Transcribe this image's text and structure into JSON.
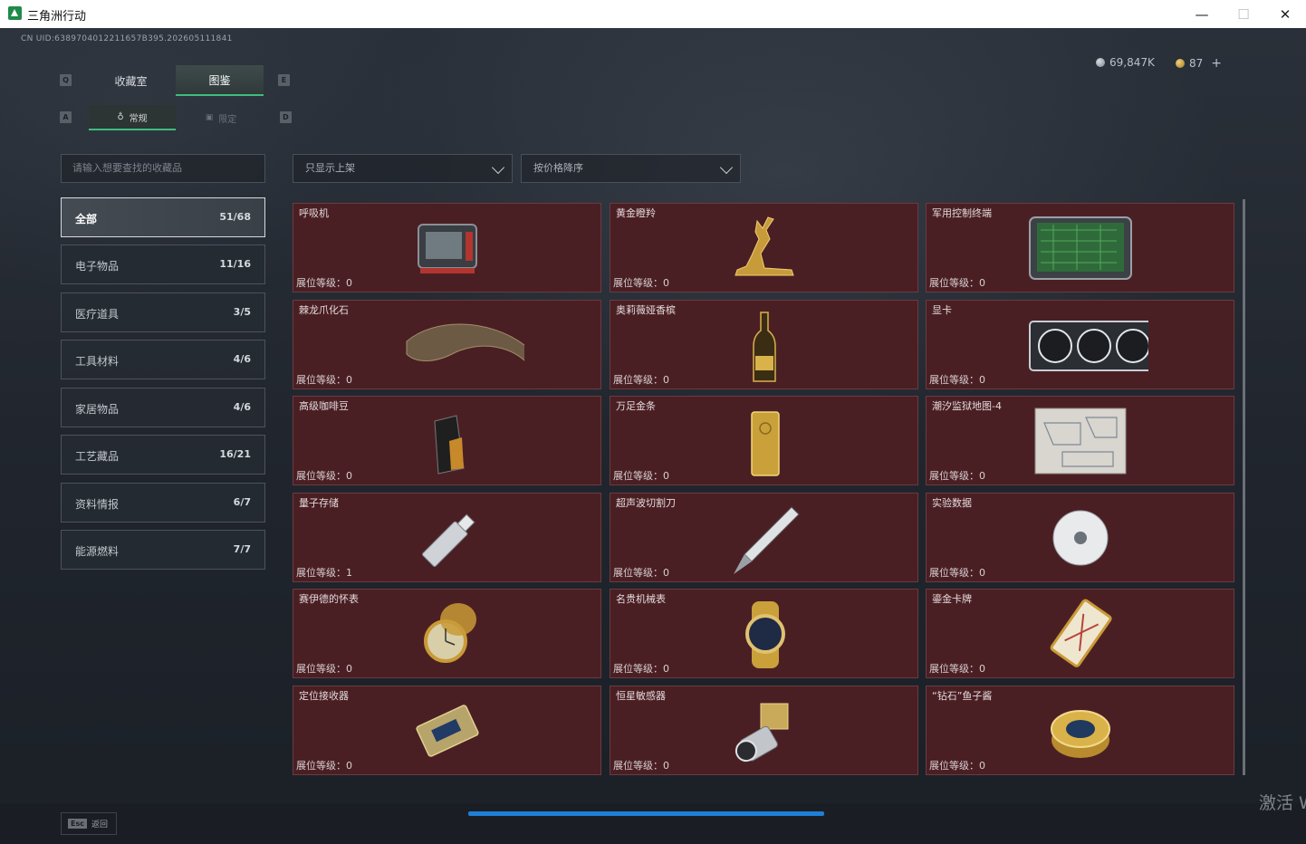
{
  "window": {
    "title": "三角洲行动",
    "minimize": "—",
    "maximize": "☐",
    "close": "✕"
  },
  "header": {
    "uid": "CN UID:6389704012211657B395.202605111841",
    "currency_primary": "69,847K",
    "currency_secondary": "87",
    "add_label": "+"
  },
  "tabs": {
    "key_left": "Q",
    "key_right": "E",
    "items": [
      {
        "label": "收藏室",
        "active": false
      },
      {
        "label": "图鉴",
        "active": true
      }
    ]
  },
  "subtabs": {
    "key_left": "A",
    "key_right": "D",
    "items": [
      {
        "label": "常规",
        "active": true
      },
      {
        "label": "限定",
        "active": false
      }
    ]
  },
  "search": {
    "placeholder": "请输入想要查找的收藏品"
  },
  "filters": {
    "shelf_filter": "只显示上架",
    "sort": "按价格降序"
  },
  "categories": [
    {
      "name": "全部",
      "count": "51/68",
      "active": true
    },
    {
      "name": "电子物品",
      "count": "11/16",
      "active": false
    },
    {
      "name": "医疗道具",
      "count": "3/5",
      "active": false
    },
    {
      "name": "工具材料",
      "count": "4/6",
      "active": false
    },
    {
      "name": "家居物品",
      "count": "4/6",
      "active": false
    },
    {
      "name": "工艺藏品",
      "count": "16/21",
      "active": false
    },
    {
      "name": "资料情报",
      "count": "6/7",
      "active": false
    },
    {
      "name": "能源燃料",
      "count": "7/7",
      "active": false
    }
  ],
  "items": [
    {
      "name": "呼吸机",
      "level": "展位等级：0",
      "icon": "ventilator"
    },
    {
      "name": "黄金瞪羚",
      "level": "展位等级：0",
      "icon": "gold-gazelle"
    },
    {
      "name": "军用控制终端",
      "level": "展位等级：0",
      "icon": "control-terminal"
    },
    {
      "name": "棘龙爪化石",
      "level": "展位等级：0",
      "icon": "claw-fossil"
    },
    {
      "name": "奥莉薇娅香槟",
      "level": "展位等级：0",
      "icon": "champagne"
    },
    {
      "name": "显卡",
      "level": "展位等级：0",
      "icon": "graphics-card"
    },
    {
      "name": "高级咖啡豆",
      "level": "展位等级：0",
      "icon": "coffee-bag"
    },
    {
      "name": "万足金条",
      "level": "展位等级：0",
      "icon": "gold-bar"
    },
    {
      "name": "潮汐监狱地图-4",
      "level": "展位等级：0",
      "icon": "map"
    },
    {
      "name": "量子存储",
      "level": "展位等级：1",
      "icon": "usb-drive"
    },
    {
      "name": "超声波切割刀",
      "level": "展位等级：0",
      "icon": "cutter"
    },
    {
      "name": "实验数据",
      "level": "展位等级：0",
      "icon": "disc"
    },
    {
      "name": "赛伊德的怀表",
      "level": "展位等级：0",
      "icon": "pocket-watch"
    },
    {
      "name": "名贵机械表",
      "level": "展位等级：0",
      "icon": "wristwatch"
    },
    {
      "name": "鎏金卡牌",
      "level": "展位等级：0",
      "icon": "gilded-card"
    },
    {
      "name": "定位接收器",
      "level": "展位等级：0",
      "icon": "receiver"
    },
    {
      "name": "恒星敏感器",
      "level": "展位等级：0",
      "icon": "star-sensor"
    },
    {
      "name": "“钻石”鱼子酱",
      "level": "展位等级：0",
      "icon": "caviar-tin"
    }
  ],
  "footer": {
    "esc_key": "Esc",
    "back_label": "返回"
  },
  "watermark": "激活 W",
  "colors": {
    "accent": "#3dbd7d",
    "card_bg": "#4a1f24",
    "progress": "#1e7fd6"
  }
}
